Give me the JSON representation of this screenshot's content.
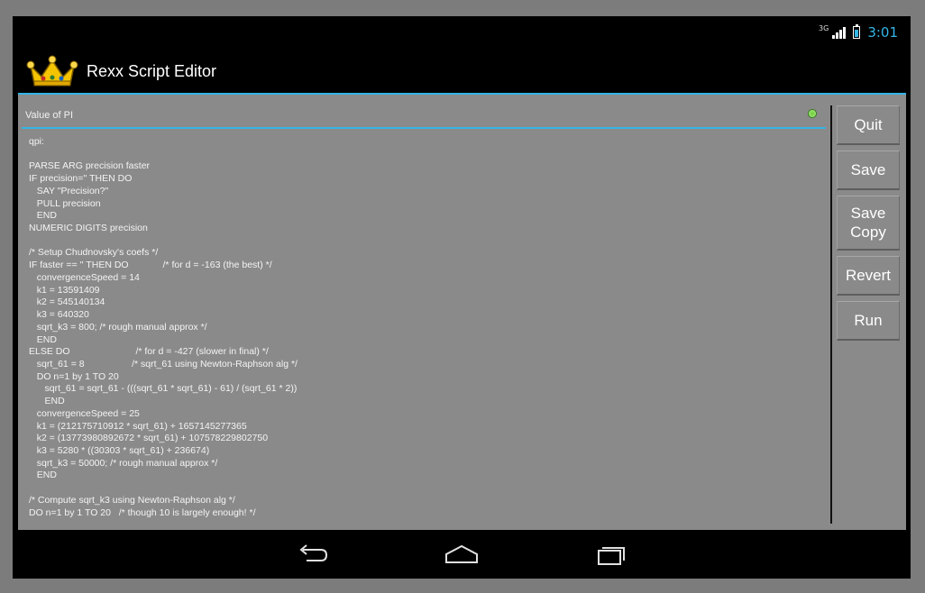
{
  "status_bar": {
    "network": "3G",
    "time": "3:01",
    "icons": [
      "signal-icon",
      "battery-icon"
    ]
  },
  "app": {
    "title": "Rexx Script Editor",
    "icon": "crown-icon"
  },
  "editor": {
    "script_title": "Value of PI",
    "status_indicator": "green",
    "code": "qpi:\n\nPARSE ARG precision faster\nIF precision='' THEN DO\n   SAY \"Precision?\"\n   PULL precision\n   END\nNUMERIC DIGITS precision\n\n/* Setup Chudnovsky's coefs */\nIF faster == '' THEN DO             /* for d = -163 (the best) */\n   convergenceSpeed = 14\n   k1 = 13591409\n   k2 = 545140134\n   k3 = 640320\n   sqrt_k3 = 800; /* rough manual approx */\n   END\nELSE DO                         /* for d = -427 (slower in final) */\n   sqrt_61 = 8                  /* sqrt_61 using Newton-Raphson alg */\n   DO n=1 by 1 TO 20\n      sqrt_61 = sqrt_61 - (((sqrt_61 * sqrt_61) - 61) / (sqrt_61 * 2))\n      END\n   convergenceSpeed = 25\n   k1 = (212175710912 * sqrt_61) + 1657145277365\n   k2 = (13773980892672 * sqrt_61) + 107578229802750\n   k3 = 5280 * ((30303 * sqrt_61) + 236674)\n   sqrt_k3 = 50000; /* rough manual approx */\n   END\n\n/* Compute sqrt_k3 using Newton-Raphson alg */\nDO n=1 by 1 TO 20   /* though 10 is largely enough! */"
  },
  "buttons": {
    "quit": "Quit",
    "save": "Save",
    "save_copy": "Save\nCopy",
    "revert": "Revert",
    "run": "Run"
  },
  "nav": {
    "back": "back-icon",
    "home": "home-icon",
    "recents": "recents-icon"
  },
  "colors": {
    "accent": "#33b5e5",
    "content_bg": "#8a8a8a",
    "status_dot": "#7cd44a"
  }
}
